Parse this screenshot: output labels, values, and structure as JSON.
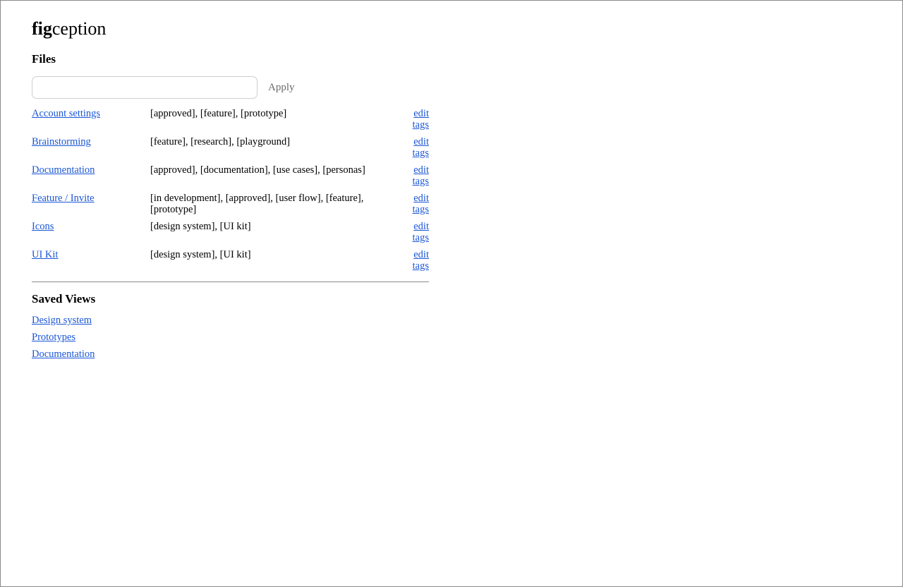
{
  "logo": {
    "bold_part": "fig",
    "normal_part": "ception"
  },
  "files": {
    "heading": "Files",
    "filter": {
      "value": "",
      "placeholder": ""
    },
    "apply_label": "Apply",
    "rows": [
      {
        "name": "Account settings",
        "tags": "[approved], [feature], [prototype]",
        "edit_label": "edit tags"
      },
      {
        "name": "Brainstorming",
        "tags": "[feature], [research], [playground]",
        "edit_label": "edit tags"
      },
      {
        "name": "Documentation",
        "tags": "[approved], [documentation], [use cases], [personas]",
        "edit_label": "edit tags"
      },
      {
        "name": "Feature / Invite",
        "tags": "[in development], [approved], [user flow], [feature], [prototype]",
        "edit_label": "edit tags"
      },
      {
        "name": "Icons",
        "tags": "[design system], [UI kit]",
        "edit_label": "edit tags"
      },
      {
        "name": "UI Kit",
        "tags": "[design system], [UI kit]",
        "edit_label": "edit tags"
      }
    ]
  },
  "saved_views": {
    "heading": "Saved Views",
    "items": [
      {
        "label": "Design system"
      },
      {
        "label": "Prototypes"
      },
      {
        "label": "Documentation"
      }
    ]
  },
  "colors": {
    "link": "#1a56d6",
    "border": "#8a8a8a",
    "input_border": "#cfcfcf",
    "muted_button": "#6a6a6a"
  }
}
